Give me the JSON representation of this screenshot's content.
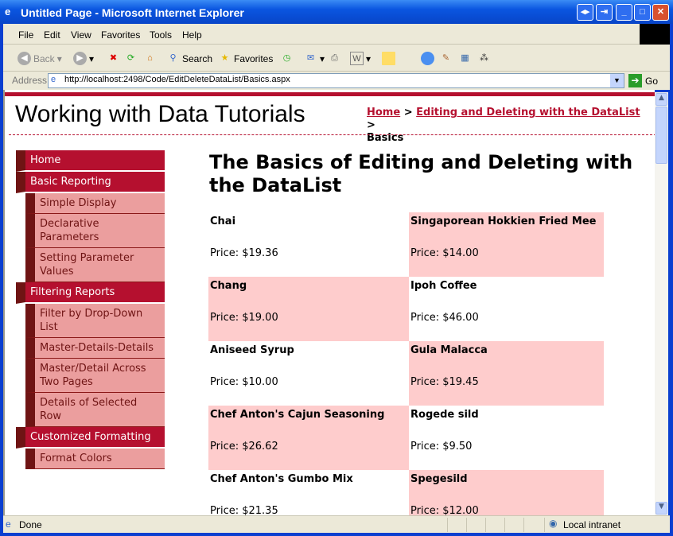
{
  "window": {
    "title": "Untitled Page - Microsoft Internet Explorer"
  },
  "menubar": [
    "File",
    "Edit",
    "View",
    "Favorites",
    "Tools",
    "Help"
  ],
  "toolbar": {
    "back": "Back",
    "search": "Search",
    "favorites": "Favorites"
  },
  "address": {
    "label": "Address",
    "url": "http://localhost:2498/Code/EditDeleteDataList/Basics.aspx",
    "go": "Go"
  },
  "page": {
    "site_title": "Working with Data Tutorials",
    "breadcrumb": {
      "home": "Home",
      "section": "Editing and Deleting with the DataList",
      "current": "Basics",
      "sep": ">"
    },
    "heading": "The Basics of Editing and Deleting with the DataList",
    "menu": [
      {
        "label": "Home",
        "level": 0
      },
      {
        "label": "Basic Reporting",
        "level": 0
      },
      {
        "label": "Simple Display",
        "level": 1
      },
      {
        "label": "Declarative Parameters",
        "level": 1
      },
      {
        "label": "Setting Parameter Values",
        "level": 1
      },
      {
        "label": "Filtering Reports",
        "level": 0
      },
      {
        "label": "Filter by Drop-Down List",
        "level": 1
      },
      {
        "label": "Master-Details-Details",
        "level": 1
      },
      {
        "label": "Master/Detail Across Two Pages",
        "level": 1
      },
      {
        "label": "Details of Selected Row",
        "level": 1
      },
      {
        "label": "Customized Formatting",
        "level": 0
      },
      {
        "label": "Format Colors",
        "level": 1
      }
    ],
    "products": [
      {
        "name": "Chai",
        "price": "Price: $19.36"
      },
      {
        "name": "Singaporean Hokkien Fried Mee",
        "price": "Price: $14.00"
      },
      {
        "name": "Chang",
        "price": "Price: $19.00"
      },
      {
        "name": "Ipoh Coffee",
        "price": "Price: $46.00"
      },
      {
        "name": "Aniseed Syrup",
        "price": "Price: $10.00"
      },
      {
        "name": "Gula Malacca",
        "price": "Price: $19.45"
      },
      {
        "name": "Chef Anton's Cajun Seasoning",
        "price": "Price: $26.62"
      },
      {
        "name": "Rogede sild",
        "price": "Price: $9.50"
      },
      {
        "name": "Chef Anton's Gumbo Mix",
        "price": "Price: $21.35"
      },
      {
        "name": "Spegesild",
        "price": "Price: $12.00"
      }
    ],
    "colors": {
      "brand": "#b5102f",
      "alt_row": "#fecccc",
      "submenu": "#eb9e9e"
    }
  },
  "status": {
    "text": "Done",
    "zone": "Local intranet"
  }
}
